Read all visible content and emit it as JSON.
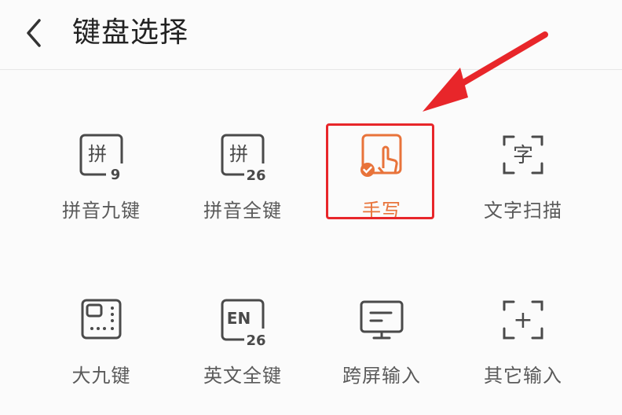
{
  "header": {
    "title": "键盘选择",
    "back_icon": "chevron-left-icon"
  },
  "keyboards": [
    {
      "label": "拼音九键",
      "icon": "pinyin-9-icon",
      "icon_text": "拼",
      "badge": "9",
      "selected": false
    },
    {
      "label": "拼音全键",
      "icon": "pinyin-26-icon",
      "icon_text": "拼",
      "badge": "26",
      "selected": false
    },
    {
      "label": "手写",
      "icon": "handwriting-icon",
      "selected": true
    },
    {
      "label": "文字扫描",
      "icon": "text-scan-icon",
      "icon_text": "字",
      "selected": false
    },
    {
      "label": "大九键",
      "icon": "big-nine-key-icon",
      "selected": false
    },
    {
      "label": "英文全键",
      "icon": "english-26-icon",
      "icon_text": "EN",
      "badge": "26",
      "selected": false
    },
    {
      "label": "跨屏输入",
      "icon": "cross-screen-icon",
      "selected": false
    },
    {
      "label": "其它输入",
      "icon": "other-input-icon",
      "icon_text": "+",
      "selected": false
    }
  ],
  "colors": {
    "accent": "#e8733a",
    "highlight_border": "#e8262a",
    "arrow": "#e8262a",
    "icon_stroke": "#4a4a4a"
  }
}
